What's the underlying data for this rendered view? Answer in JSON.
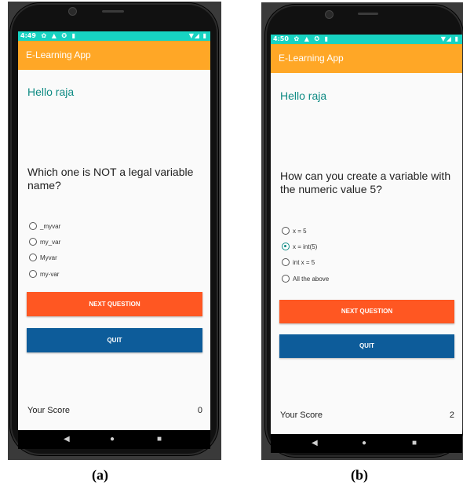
{
  "phones": [
    {
      "status_time": "4:49",
      "status_icons": "✿ ▲ ✪ ▮",
      "status_right": "▼◢ ▮",
      "app_title": "E-Learning App",
      "greeting": "Hello raja",
      "question": "Which one is NOT a legal variable name?",
      "options": [
        "_myvar",
        "my_var",
        "Myvar",
        "my-var"
      ],
      "selected_index": -1,
      "next_label": "NEXT QUESTION",
      "quit_label": "QUIT",
      "score_label": "Your Score",
      "score_value": "0",
      "caption": "(a)"
    },
    {
      "status_time": "4:50",
      "status_icons": "✿ ▲ ✪ ▮",
      "status_right": "▼◢ ▮",
      "app_title": "E-Learning App",
      "greeting": "Hello raja",
      "question": "How can you create a variable with the numeric value 5?",
      "options": [
        "x = 5",
        "x = int(5)",
        "int x = 5",
        "All the above"
      ],
      "selected_index": 1,
      "next_label": "NEXT QUESTION",
      "quit_label": "QUIT",
      "score_label": "Your Score",
      "score_value": "2",
      "caption": "(b)"
    }
  ],
  "nav": {
    "back_icon": "◀",
    "home_icon": "●",
    "recents_icon": "■"
  },
  "colors": {
    "status_bar": "#17d3c2",
    "app_bar": "#ffa726",
    "next_button": "#ff5722",
    "quit_button": "#0d5c9a",
    "greeting": "#0f8b84"
  }
}
